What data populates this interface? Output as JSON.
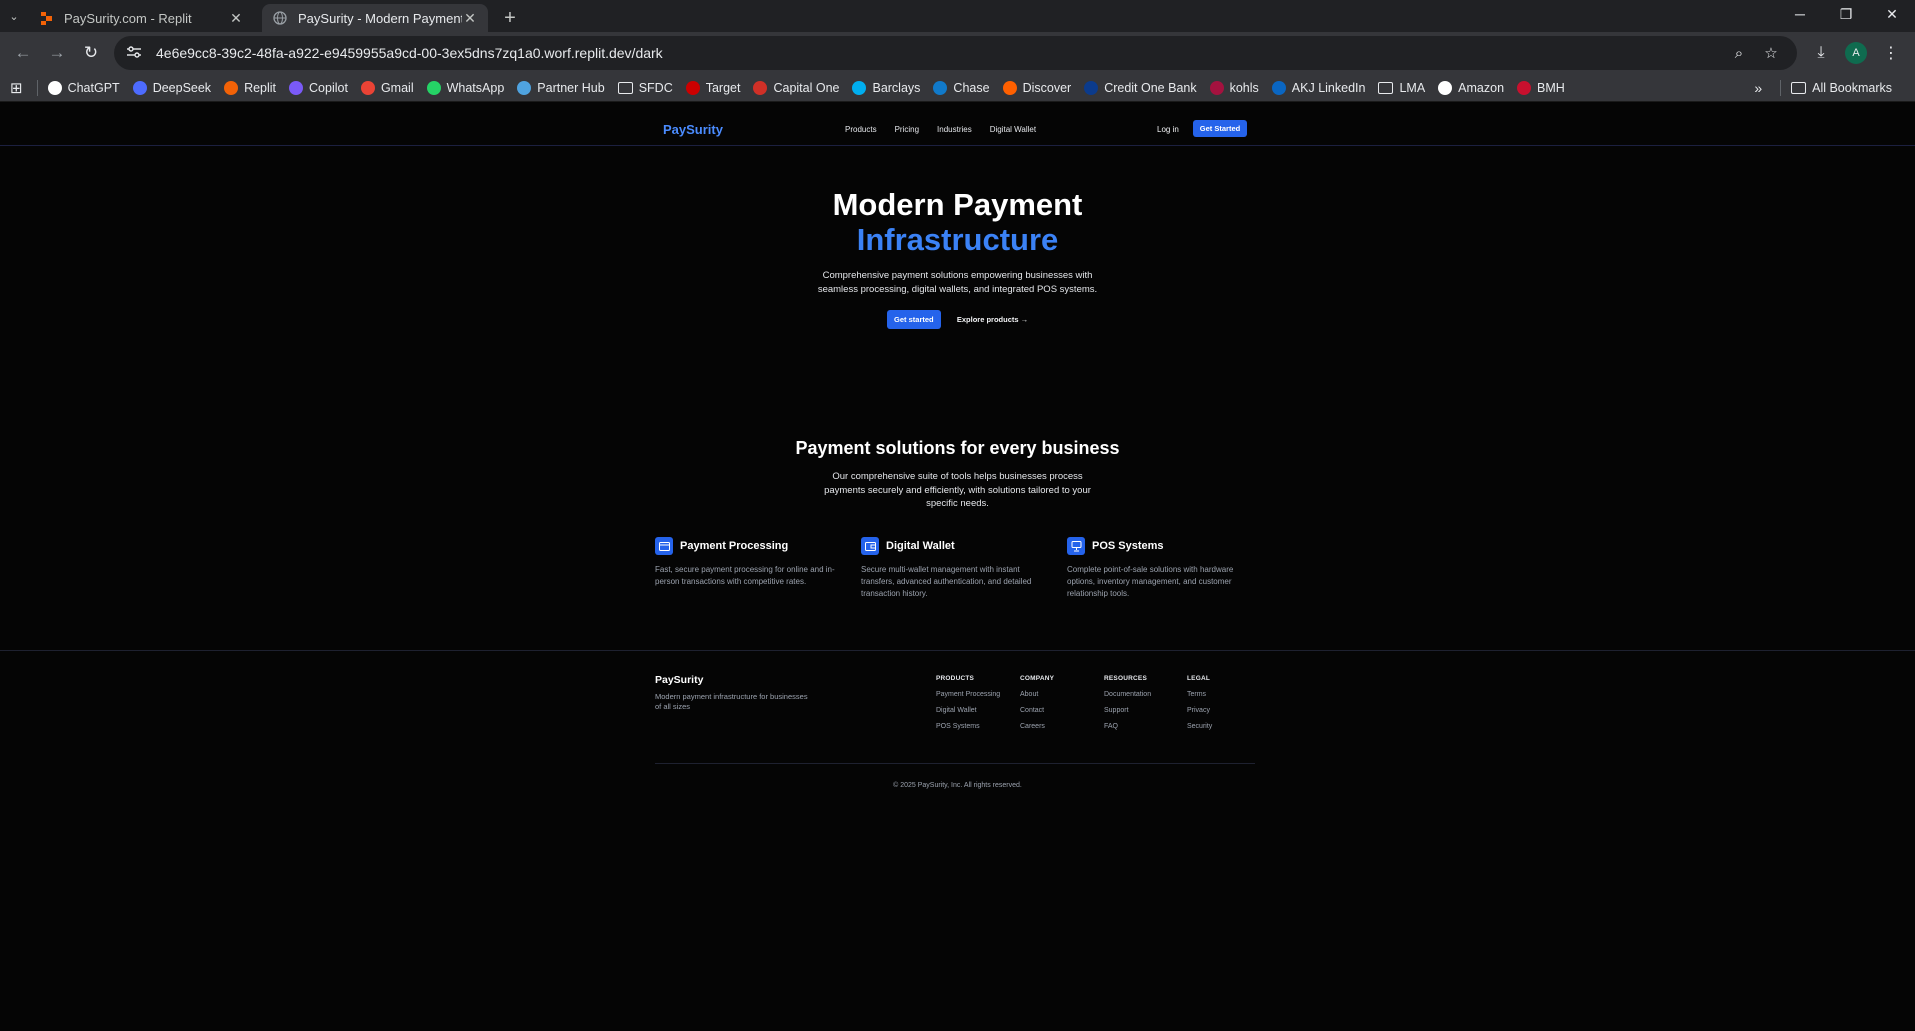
{
  "browser": {
    "tabs": [
      {
        "title": "PaySurity.com - Replit",
        "active": false,
        "favicon": "replit-icon"
      },
      {
        "title": "PaySurity - Modern Payment Inf",
        "active": true,
        "favicon": "globe-icon"
      }
    ],
    "url": "4e6e9cc8-39c2-48fa-a922-e9459955a9cd-00-3ex5dns7zq1a0.worf.replit.dev/dark",
    "avatar_letter": "A",
    "bookmarks": [
      {
        "label": "ChatGPT",
        "color": "#ffffff"
      },
      {
        "label": "DeepSeek",
        "color": "#4d6bfe"
      },
      {
        "label": "Replit",
        "color": "#f26207"
      },
      {
        "label": "Copilot",
        "color": "#7a5af8"
      },
      {
        "label": "Gmail",
        "color": "#ea4335"
      },
      {
        "label": "WhatsApp",
        "color": "#25d366"
      },
      {
        "label": "Partner Hub",
        "color": "#4fa3e0"
      },
      {
        "label": "SFDC",
        "color": "folder"
      },
      {
        "label": "Target",
        "color": "#cc0000"
      },
      {
        "label": "Capital One",
        "color": "#d03027"
      },
      {
        "label": "Barclays",
        "color": "#00aeef"
      },
      {
        "label": "Chase",
        "color": "#117aca"
      },
      {
        "label": "Discover",
        "color": "#ff6000"
      },
      {
        "label": "Credit One Bank",
        "color": "#0b3b8c"
      },
      {
        "label": "kohls",
        "color": "#a4123f"
      },
      {
        "label": "AKJ LinkedIn",
        "color": "#0a66c2"
      },
      {
        "label": "LMA",
        "color": "folder"
      },
      {
        "label": "Amazon",
        "color": "#ffffff"
      },
      {
        "label": "BMH",
        "color": "#c8102e"
      }
    ],
    "all_bookmarks": "All Bookmarks"
  },
  "site": {
    "brand": "PaySurity",
    "nav": [
      "Products",
      "Pricing",
      "Industries",
      "Digital Wallet"
    ],
    "login": "Log in",
    "get_started": "Get Started",
    "hero": {
      "title_line1": "Modern Payment",
      "title_line2": "Infrastructure",
      "description": "Comprehensive payment solutions empowering businesses with seamless processing, digital wallets, and integrated POS systems.",
      "cta_primary": "Get started",
      "cta_secondary": "Explore products →"
    },
    "solutions": {
      "title": "Payment solutions for every business",
      "subtitle": "Our comprehensive suite of tools helps businesses process payments securely and efficiently, with solutions tailored to your specific needs.",
      "features": [
        {
          "title": "Payment Processing",
          "icon": "credit-card-icon",
          "description": "Fast, secure payment processing for online and in-person transactions with competitive rates."
        },
        {
          "title": "Digital Wallet",
          "icon": "wallet-icon",
          "description": "Secure multi-wallet management with instant transfers, advanced authentication, and detailed transaction history."
        },
        {
          "title": "POS Systems",
          "icon": "pos-terminal-icon",
          "description": "Complete point-of-sale solutions with hardware options, inventory management, and customer relationship tools."
        }
      ]
    },
    "footer": {
      "brand": "PaySurity",
      "tagline": "Modern payment infrastructure for businesses of all sizes",
      "columns": [
        {
          "heading": "PRODUCTS",
          "links": [
            "Payment Processing",
            "Digital Wallet",
            "POS Systems"
          ]
        },
        {
          "heading": "COMPANY",
          "links": [
            "About",
            "Contact",
            "Careers"
          ]
        },
        {
          "heading": "RESOURCES",
          "links": [
            "Documentation",
            "Support",
            "FAQ"
          ]
        },
        {
          "heading": "LEGAL",
          "links": [
            "Terms",
            "Privacy",
            "Security"
          ]
        }
      ],
      "copyright": "© 2025 PaySurity, Inc. All rights reserved."
    },
    "colors": {
      "accent": "#2563eb",
      "accent_text": "#3b82f6",
      "background": "#050505"
    }
  }
}
